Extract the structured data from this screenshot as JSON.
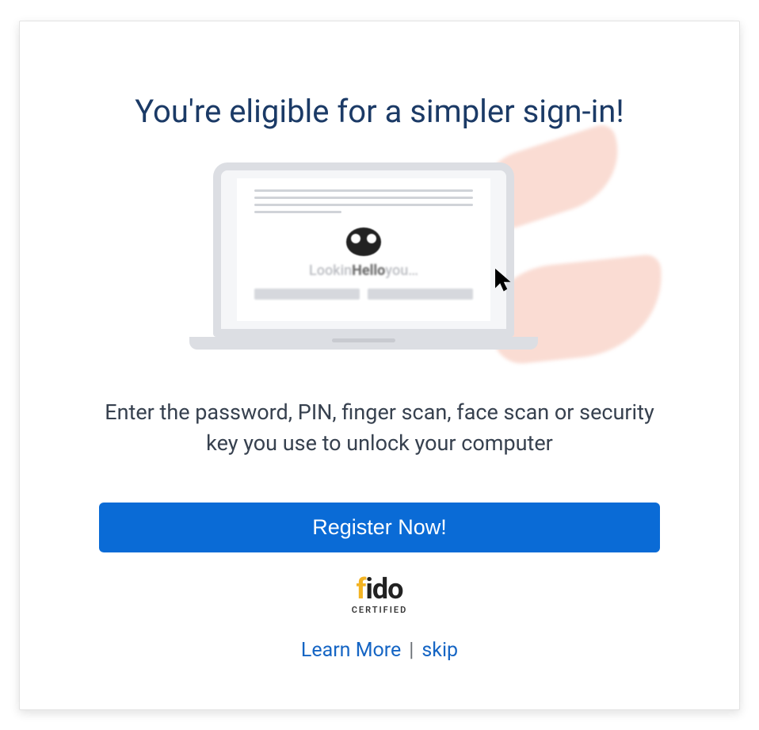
{
  "heading": "You're eligible for a simpler sign-in!",
  "illustration": {
    "screen_text_prefix": "Lookin",
    "screen_text_bold": "Hello",
    "screen_text_suffix": "you…"
  },
  "description": "Enter the password, PIN, finger scan, face scan or security key you use to unlock your computer",
  "register_button": "Register Now!",
  "fido": {
    "f": "f",
    "ido": "ido",
    "certified": "CERTIFIED"
  },
  "links": {
    "learn_more": "Learn More",
    "separator": "|",
    "skip": "skip"
  }
}
